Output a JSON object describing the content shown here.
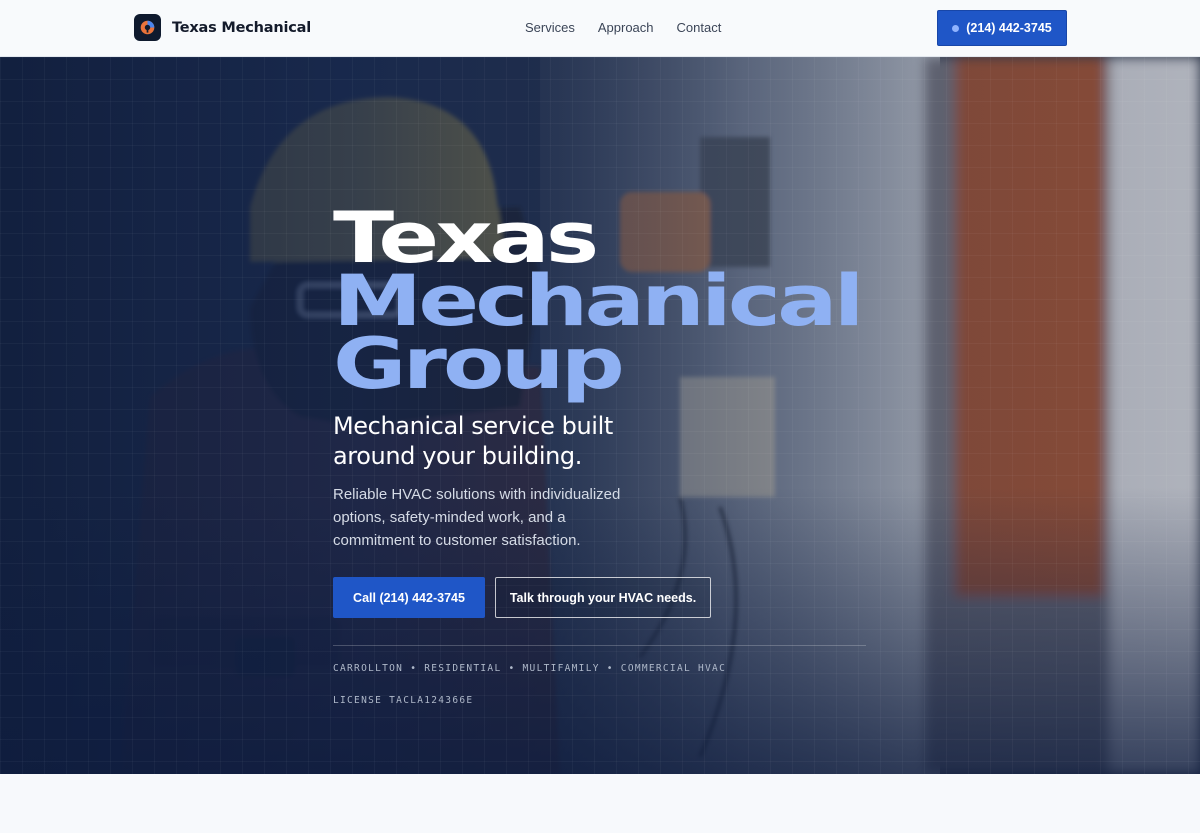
{
  "header": {
    "brand": "Texas Mechanical",
    "nav": [
      {
        "label": "Services"
      },
      {
        "label": "Approach"
      },
      {
        "label": "Contact"
      }
    ],
    "cta_label": "(214) 442-3745"
  },
  "hero": {
    "title_line1": "Texas",
    "title_line2": "Mechanical",
    "title_line3": "Group",
    "subtitle": "Mechanical service built around your building.",
    "description": "Reliable HVAC solutions with individualized options, safety-minded work, and a commitment to customer satisfaction.",
    "primary_button": "Call (214) 442-3745",
    "secondary_button": "Talk through your HVAC needs.",
    "service_areas": "CARROLLTON • RESIDENTIAL • MULTIFAMILY • COMMERCIAL HVAC",
    "license": "LICENSE TACLA124366E"
  },
  "colors": {
    "accent": "#1f56c7",
    "title_accent": "#8fb1f3",
    "hero_overlay": "#101e3e"
  },
  "icons": {
    "logo": "gauge-logo-icon",
    "cta": "status-dot-icon"
  }
}
